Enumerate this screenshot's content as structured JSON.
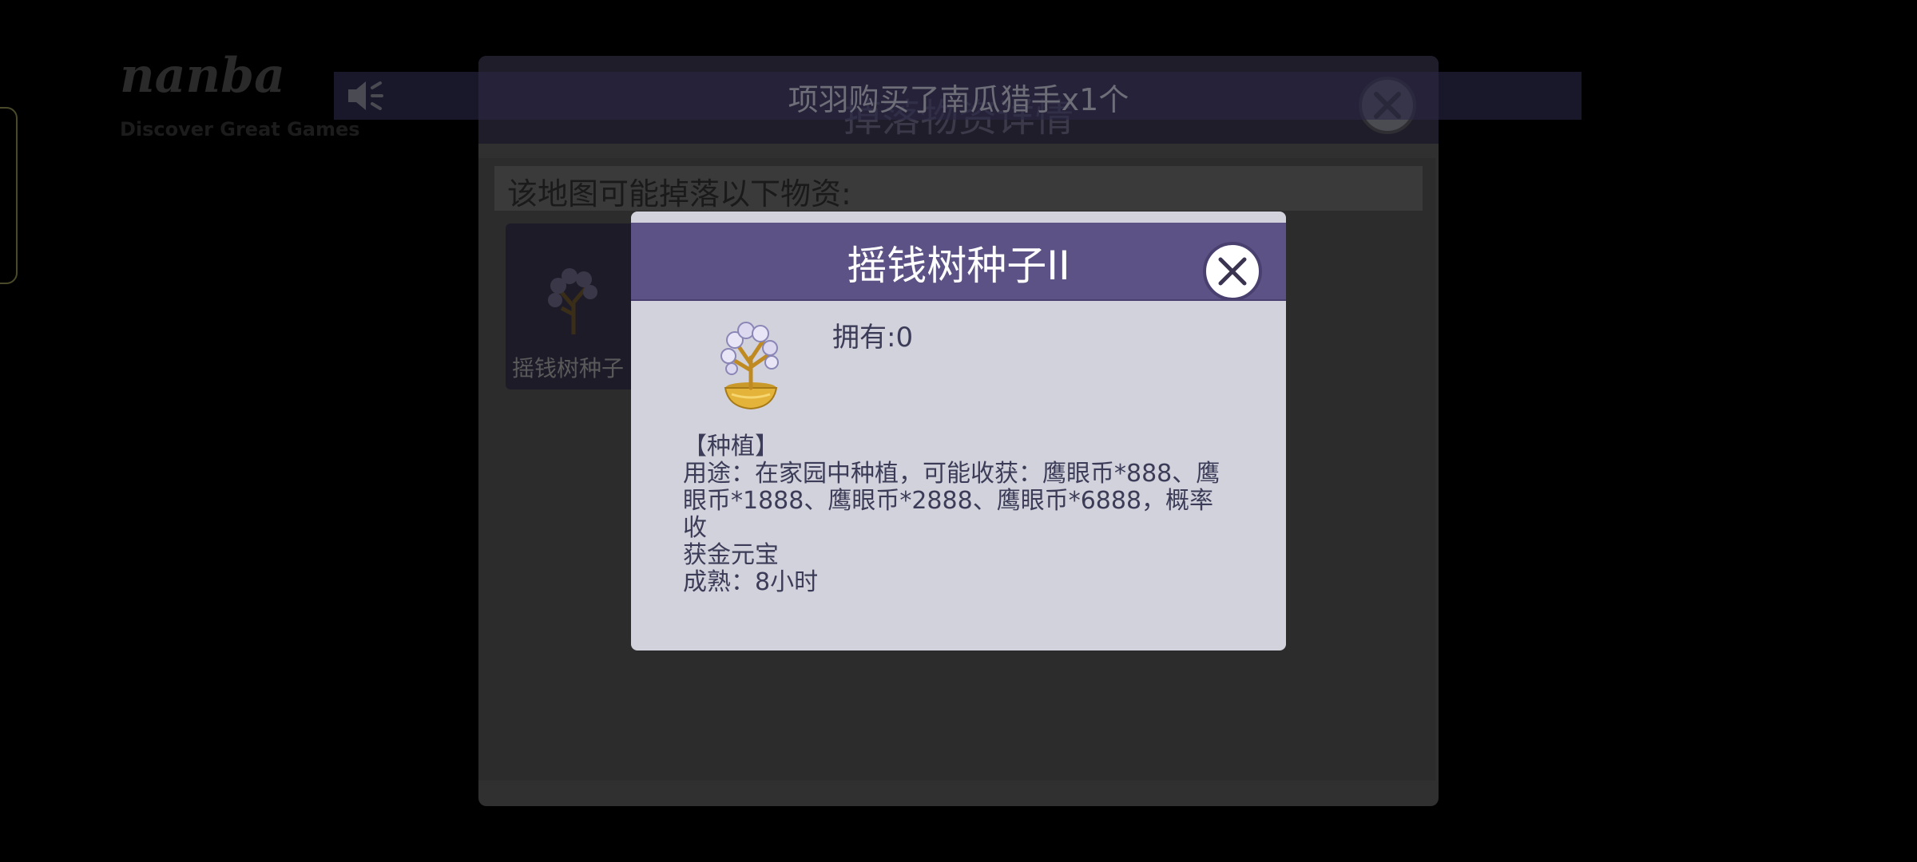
{
  "background": {
    "logo_text": "nanba",
    "sub_text": "Discover Great Games"
  },
  "drop_panel": {
    "title": "掉落物资详情",
    "subtitle": "该地图可能掉落以下物资:",
    "items": [
      {
        "label": "摇钱树种子"
      }
    ]
  },
  "notice": {
    "text": "项羽购买了南瓜猎手x1个"
  },
  "item_detail": {
    "title": "摇钱树种子II",
    "owned": "拥有:0",
    "category": "【种植】",
    "usage_lines": [
      "用途：在家园中种植，可能收获：鹰眼币*888、鹰",
      "眼币*1888、鹰眼币*2888、鹰眼币*6888，概率收",
      "获金元宝"
    ],
    "maturity": "成熟：8小时"
  },
  "colors": {
    "header_purple": "#5d5285",
    "modal_bg": "#d2d2dc",
    "text_dark": "#3c3c58"
  },
  "icons": {
    "close": "close-icon",
    "speaker": "speaker-icon",
    "money_tree": "money-tree-icon"
  }
}
